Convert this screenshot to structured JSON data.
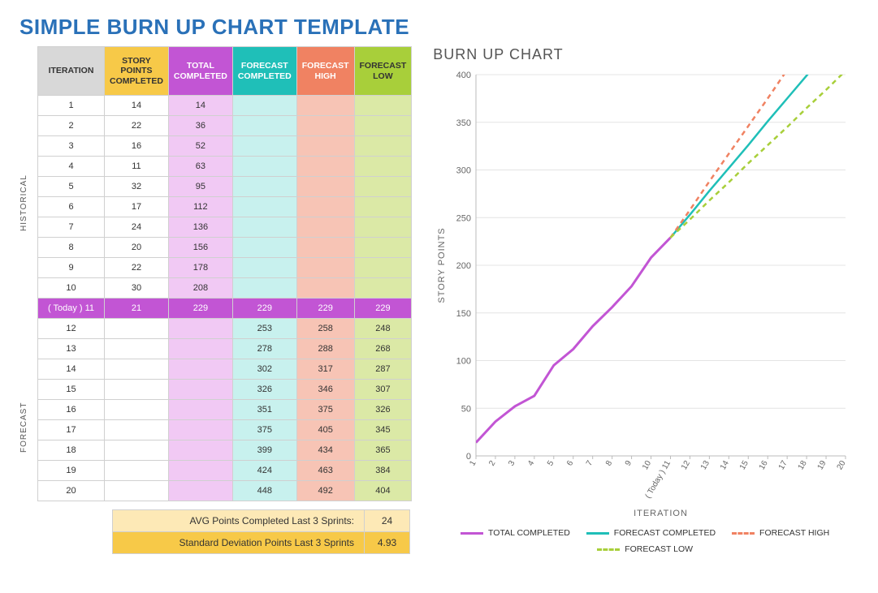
{
  "page_title": "SIMPLE BURN UP CHART TEMPLATE",
  "section_labels": {
    "historical": "HISTORICAL",
    "forecast": "FORECAST"
  },
  "table": {
    "headers": [
      "ITERATION",
      "STORY POINTS COMPLETED",
      "TOTAL COMPLETED",
      "FORECAST COMPLETED",
      "FORECAST HIGH",
      "FORECAST LOW"
    ],
    "rows": [
      {
        "iter": "1",
        "sp": "14",
        "tot": "14",
        "fc": "",
        "fh": "",
        "fl": "",
        "today": false,
        "forecast": false
      },
      {
        "iter": "2",
        "sp": "22",
        "tot": "36",
        "fc": "",
        "fh": "",
        "fl": "",
        "today": false,
        "forecast": false
      },
      {
        "iter": "3",
        "sp": "16",
        "tot": "52",
        "fc": "",
        "fh": "",
        "fl": "",
        "today": false,
        "forecast": false
      },
      {
        "iter": "4",
        "sp": "11",
        "tot": "63",
        "fc": "",
        "fh": "",
        "fl": "",
        "today": false,
        "forecast": false
      },
      {
        "iter": "5",
        "sp": "32",
        "tot": "95",
        "fc": "",
        "fh": "",
        "fl": "",
        "today": false,
        "forecast": false
      },
      {
        "iter": "6",
        "sp": "17",
        "tot": "112",
        "fc": "",
        "fh": "",
        "fl": "",
        "today": false,
        "forecast": false
      },
      {
        "iter": "7",
        "sp": "24",
        "tot": "136",
        "fc": "",
        "fh": "",
        "fl": "",
        "today": false,
        "forecast": false
      },
      {
        "iter": "8",
        "sp": "20",
        "tot": "156",
        "fc": "",
        "fh": "",
        "fl": "",
        "today": false,
        "forecast": false
      },
      {
        "iter": "9",
        "sp": "22",
        "tot": "178",
        "fc": "",
        "fh": "",
        "fl": "",
        "today": false,
        "forecast": false
      },
      {
        "iter": "10",
        "sp": "30",
        "tot": "208",
        "fc": "",
        "fh": "",
        "fl": "",
        "today": false,
        "forecast": false
      },
      {
        "iter": "( Today ) 11",
        "sp": "21",
        "tot": "229",
        "fc": "229",
        "fh": "229",
        "fl": "229",
        "today": true,
        "forecast": false
      },
      {
        "iter": "12",
        "sp": "",
        "tot": "",
        "fc": "253",
        "fh": "258",
        "fl": "248",
        "today": false,
        "forecast": true
      },
      {
        "iter": "13",
        "sp": "",
        "tot": "",
        "fc": "278",
        "fh": "288",
        "fl": "268",
        "today": false,
        "forecast": true
      },
      {
        "iter": "14",
        "sp": "",
        "tot": "",
        "fc": "302",
        "fh": "317",
        "fl": "287",
        "today": false,
        "forecast": true
      },
      {
        "iter": "15",
        "sp": "",
        "tot": "",
        "fc": "326",
        "fh": "346",
        "fl": "307",
        "today": false,
        "forecast": true
      },
      {
        "iter": "16",
        "sp": "",
        "tot": "",
        "fc": "351",
        "fh": "375",
        "fl": "326",
        "today": false,
        "forecast": true
      },
      {
        "iter": "17",
        "sp": "",
        "tot": "",
        "fc": "375",
        "fh": "405",
        "fl": "345",
        "today": false,
        "forecast": true
      },
      {
        "iter": "18",
        "sp": "",
        "tot": "",
        "fc": "399",
        "fh": "434",
        "fl": "365",
        "today": false,
        "forecast": true
      },
      {
        "iter": "19",
        "sp": "",
        "tot": "",
        "fc": "424",
        "fh": "463",
        "fl": "384",
        "today": false,
        "forecast": true
      },
      {
        "iter": "20",
        "sp": "",
        "tot": "",
        "fc": "448",
        "fh": "492",
        "fl": "404",
        "today": false,
        "forecast": true
      }
    ]
  },
  "stats": {
    "avg_label": "AVG Points Completed Last 3 Sprints:",
    "avg_value": "24",
    "sd_label": "Standard Deviation Points Last 3 Sprints",
    "sd_value": "4.93"
  },
  "chart_title": "BURN UP CHART",
  "chart_data": {
    "type": "line",
    "xlabel": "ITERATION",
    "ylabel": "STORY POINTS",
    "x": [
      "1",
      "2",
      "3",
      "4",
      "5",
      "6",
      "7",
      "8",
      "9",
      "10",
      "( Today ) 11",
      "12",
      "13",
      "14",
      "15",
      "16",
      "17",
      "18",
      "19",
      "20"
    ],
    "ylim": [
      0,
      400
    ],
    "yticks": [
      0,
      50,
      100,
      150,
      200,
      250,
      300,
      350,
      400
    ],
    "series": [
      {
        "name": "TOTAL COMPLETED",
        "color": "#c255d4",
        "dash": "",
        "width": 3,
        "values": [
          14,
          36,
          52,
          63,
          95,
          112,
          136,
          156,
          178,
          208,
          229,
          null,
          null,
          null,
          null,
          null,
          null,
          null,
          null,
          null
        ]
      },
      {
        "name": "FORECAST COMPLETED",
        "color": "#1fbfb8",
        "dash": "",
        "width": 2.5,
        "values": [
          null,
          null,
          null,
          null,
          null,
          null,
          null,
          null,
          null,
          null,
          229,
          253,
          278,
          302,
          326,
          351,
          375,
          399,
          424,
          448
        ]
      },
      {
        "name": "FORECAST HIGH",
        "color": "#f08262",
        "dash": "6,5",
        "width": 2.5,
        "values": [
          null,
          null,
          null,
          null,
          null,
          null,
          null,
          null,
          null,
          null,
          229,
          258,
          288,
          317,
          346,
          375,
          405,
          434,
          463,
          492
        ]
      },
      {
        "name": "FORECAST LOW",
        "color": "#a8cf3a",
        "dash": "6,5",
        "width": 2.5,
        "values": [
          null,
          null,
          null,
          null,
          null,
          null,
          null,
          null,
          null,
          null,
          229,
          248,
          268,
          287,
          307,
          326,
          345,
          365,
          384,
          404
        ]
      }
    ],
    "legend": [
      "TOTAL COMPLETED",
      "FORECAST COMPLETED",
      "FORECAST HIGH",
      "FORECAST LOW"
    ]
  }
}
